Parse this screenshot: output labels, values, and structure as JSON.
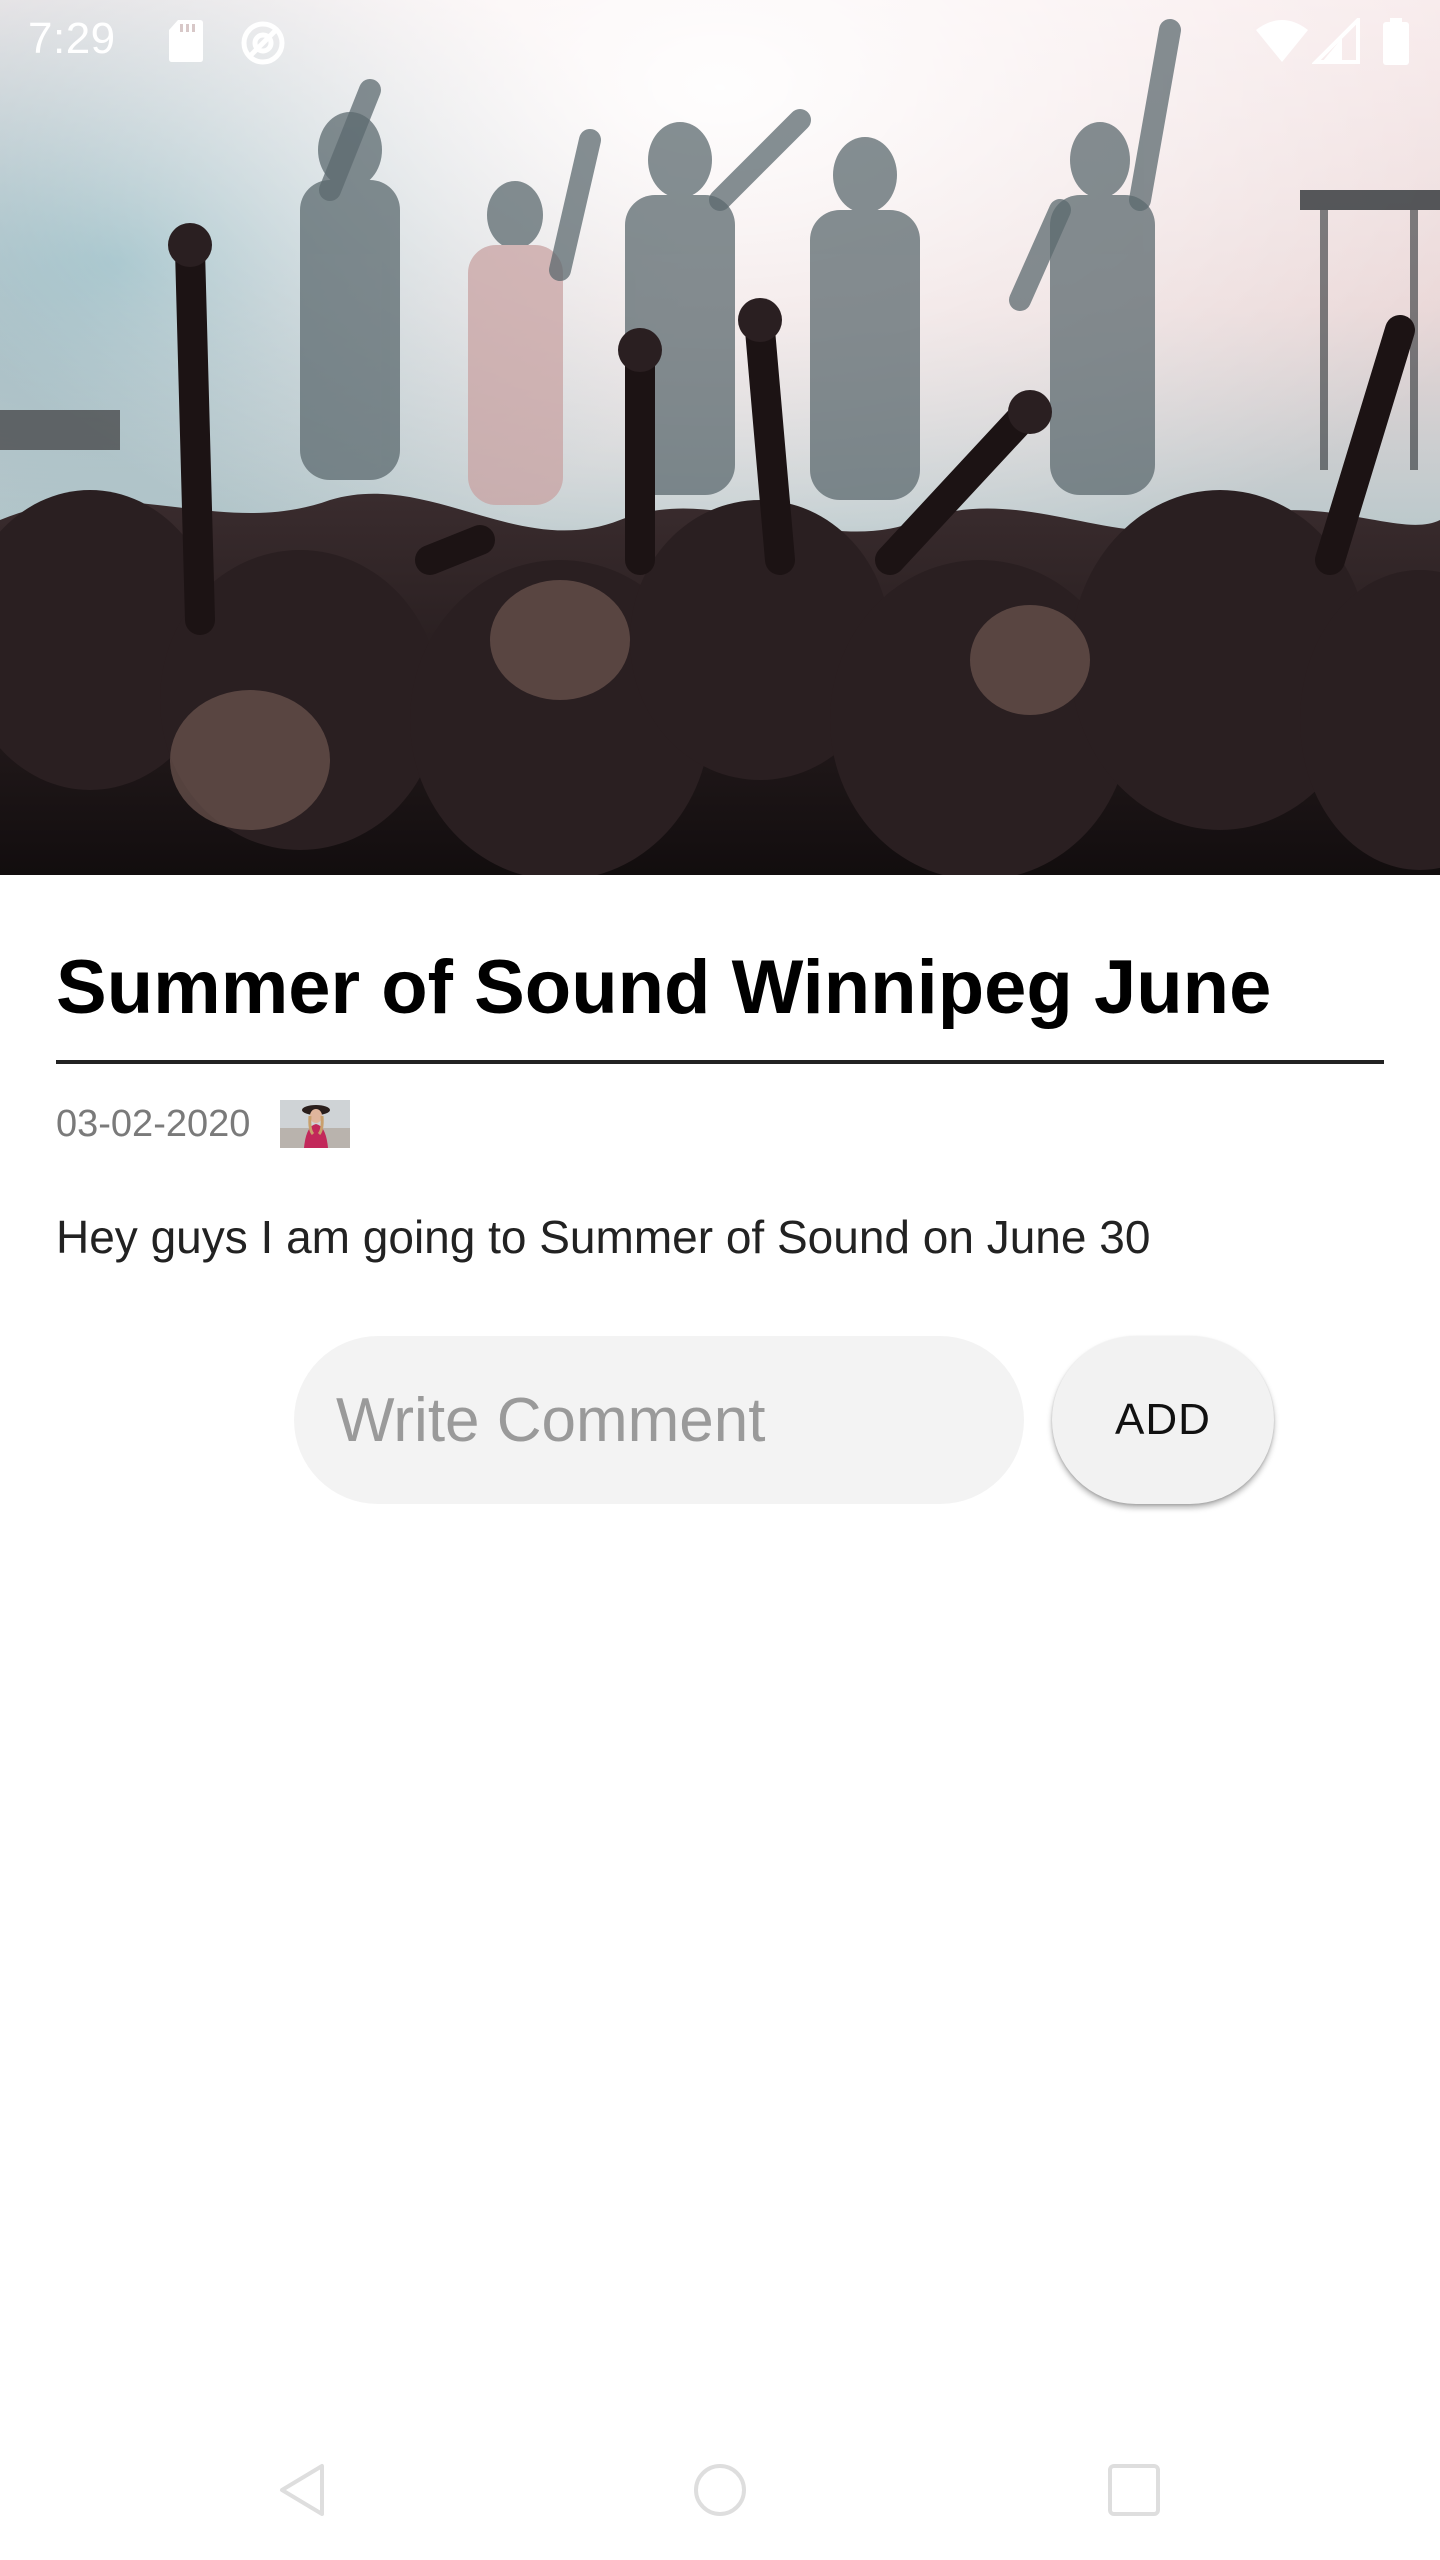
{
  "status_bar": {
    "time": "7:29",
    "left_icons": [
      "sd-card-icon",
      "sync-icon"
    ],
    "right_icons": [
      "wifi-icon",
      "cell-signal-icon",
      "battery-icon"
    ]
  },
  "hero": {
    "image": "concert-crowd-image"
  },
  "post": {
    "title": "Summer of Sound Winnipeg June",
    "date": "03-02-2020",
    "author_avatar": "author-avatar-image",
    "body": "Hey guys I am going to Summer of Sound on June 30"
  },
  "comment": {
    "placeholder": "Write Comment",
    "value": "",
    "add_label": "ADD"
  },
  "nav": {
    "icons": [
      "back-icon",
      "home-icon",
      "recents-icon"
    ]
  },
  "colors": {
    "title": "#000000",
    "meta": "#7a7a7a",
    "input_bg": "#f3f3f3",
    "button_bg": "#f2f2f2",
    "divider": "#222222"
  }
}
